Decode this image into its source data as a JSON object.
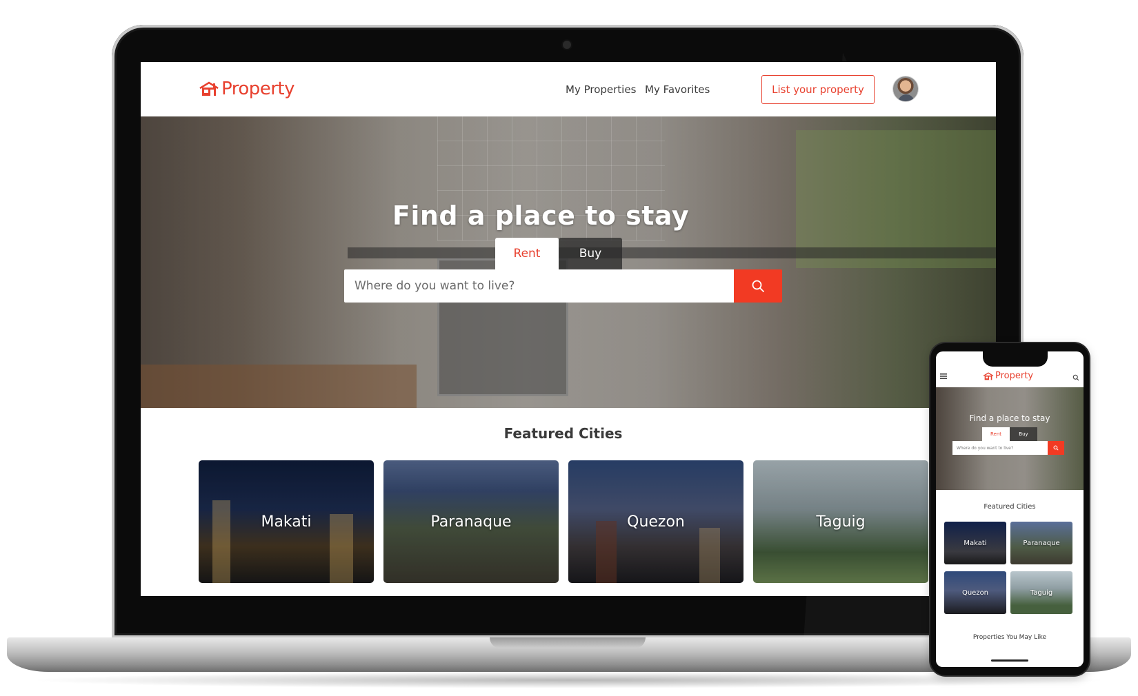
{
  "brand": {
    "name": "Property",
    "accent_color": "#e8412f",
    "logo_icon": "house-icon"
  },
  "nav": {
    "links": [
      "My Properties",
      "My Favorites"
    ],
    "cta_label": "List your property",
    "avatar_icon": "avatar"
  },
  "hero": {
    "title": "Find a place to stay",
    "tabs": [
      {
        "label": "Rent",
        "active": true
      },
      {
        "label": "Buy",
        "active": false
      }
    ],
    "search_placeholder": "Where do you want to live?",
    "search_icon": "search-icon"
  },
  "featured": {
    "title": "Featured Cities",
    "cities": [
      "Makati",
      "Paranaque",
      "Quezon",
      "Taguig"
    ]
  },
  "mobile": {
    "brand": "Property",
    "menu_icon": "menu-icon",
    "hero_title": "Find a place to stay",
    "tabs": [
      "Rent",
      "Buy"
    ],
    "search_placeholder": "Where do you want to live?",
    "featured_title": "Featured Cities",
    "cities": [
      "Makati",
      "Paranaque",
      "Quezon",
      "Taguig"
    ],
    "section_title": "Properties You May Like"
  }
}
